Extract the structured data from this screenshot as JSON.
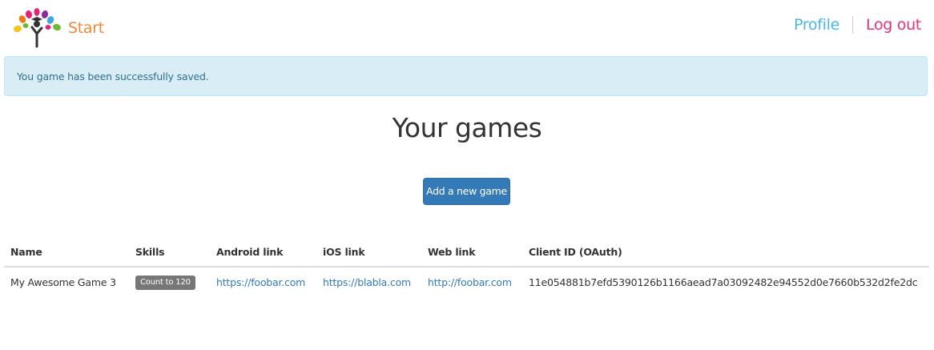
{
  "navbar": {
    "brand_label": "Start",
    "profile_label": "Profile",
    "logout_label": "Log out",
    "brand_color": "#f0883a",
    "profile_color": "#4ab8e6",
    "logout_color": "#e8317d",
    "logo_icon": "tree-logo-icon"
  },
  "alert": {
    "message": "You game has been successfully saved.",
    "type": "info"
  },
  "main": {
    "title": "Your games",
    "add_button_label": "Add a new game",
    "accent_color": "#337ab7"
  },
  "table": {
    "headers": {
      "name": "Name",
      "skills": "Skills",
      "android": "Android link",
      "ios": "iOS link",
      "web": "Web link",
      "client_id": "Client ID (OAuth)"
    },
    "rows": [
      {
        "name": "My Awesome Game 3",
        "skills": [
          "Count to 120"
        ],
        "android": "https://foobar.com",
        "ios": "https://blabla.com",
        "web": "http://foobar.com",
        "client_id": "11e054881b7efd5390126b1166aead7a03092482e94552d0e7660b532d2fe2dc"
      }
    ]
  }
}
